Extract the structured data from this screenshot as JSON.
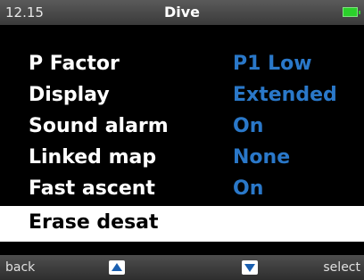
{
  "status": {
    "time": "12.15",
    "title": "Dive",
    "battery_icon": "battery-full-icon",
    "battery_color": "#2bd12b"
  },
  "menu": {
    "items": [
      {
        "label": "P Factor",
        "value": "P1 Low"
      },
      {
        "label": "Display",
        "value": "Extended"
      },
      {
        "label": "Sound alarm",
        "value": "On"
      },
      {
        "label": "Linked map",
        "value": "None"
      },
      {
        "label": "Fast ascent",
        "value": "On"
      },
      {
        "label": "Erase desat",
        "value": ""
      }
    ],
    "selected_index": 5,
    "value_color": "#2a78c9"
  },
  "bottom": {
    "back_label": "back",
    "select_label": "select",
    "up_icon": "arrow-up-icon",
    "down_icon": "arrow-down-icon"
  }
}
